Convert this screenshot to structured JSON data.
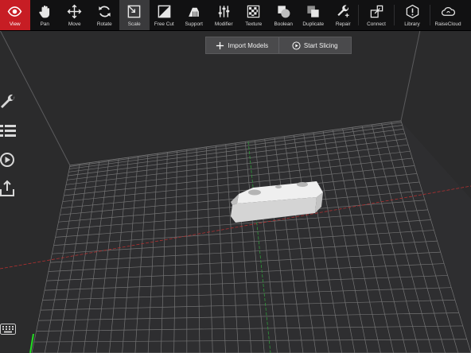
{
  "toolbar": {
    "items": [
      {
        "label": "View",
        "icon": "eye-icon"
      },
      {
        "label": "Pan",
        "icon": "hand-icon"
      },
      {
        "label": "Move",
        "icon": "move-arrows-icon"
      },
      {
        "label": "Rotate",
        "icon": "rotate-icon"
      },
      {
        "label": "Scale",
        "icon": "scale-icon"
      },
      {
        "label": "Free Cut",
        "icon": "free-cut-icon"
      },
      {
        "label": "Support",
        "icon": "support-icon"
      },
      {
        "label": "Modifier",
        "icon": "modifier-sliders-icon"
      },
      {
        "label": "Texture",
        "icon": "texture-icon"
      },
      {
        "label": "Boolean",
        "icon": "boolean-icon"
      },
      {
        "label": "Duplicate",
        "icon": "duplicate-icon"
      },
      {
        "label": "Repair",
        "icon": "repair-wrench-icon"
      },
      {
        "label": "Connect",
        "icon": "connect-icon"
      },
      {
        "label": "Library",
        "icon": "library-icon"
      },
      {
        "label": "RaiseCloud",
        "icon": "cloud-icon"
      }
    ],
    "active_item": "View",
    "selected_item": "Scale"
  },
  "actions": {
    "import_label": "Import Models",
    "slice_label": "Start Slicing"
  },
  "sidebar": {
    "items": [
      {
        "icon": "settings-wrench-icon"
      },
      {
        "icon": "model-list-icon"
      },
      {
        "icon": "preview-play-icon"
      },
      {
        "icon": "export-upload-icon"
      }
    ],
    "keyboard_icon": "keyboard-icon"
  },
  "colors": {
    "accent": "#c71d24",
    "toolbar_bg": "#111112",
    "viewport_bg": "#2b2b2c",
    "grid_line": "#8a8a8a",
    "axis_x": "#b03030",
    "axis_y": "#2f9a3a",
    "model": "#dcdcdc"
  }
}
